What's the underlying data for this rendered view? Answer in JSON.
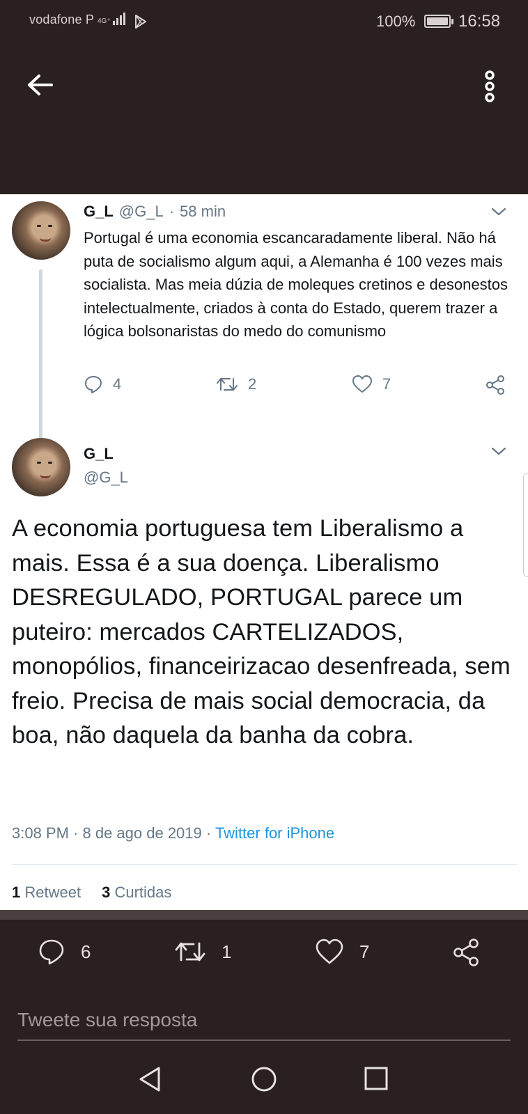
{
  "status_bar": {
    "carrier": "vodafone P",
    "network": "4G⁺",
    "battery_percent": "100%",
    "time": "16:58"
  },
  "header": {
    "back_icon": "arrow-left-icon",
    "menu_icon": "more-vertical-icon"
  },
  "parent_tweet": {
    "name": "G_L",
    "handle": "@G_L",
    "separator": "·",
    "time": "58 min",
    "text": "Portugal é uma economia escancaradamente liberal. Não há puta de socialismo algum aqui, a Alemanha é 100 vezes  mais socialista. Mas meia dúzia de moleques cretinos e desonestos intelectualmente, criados à conta do Estado, querem trazer a lógica bolsonaristas do medo do comunismo",
    "replies": "4",
    "retweets": "2",
    "likes": "7"
  },
  "main_tweet": {
    "name": "G_L",
    "handle": "@G_L",
    "text": "A economia portuguesa tem Liberalismo a mais. Essa é a sua doença. Liberalismo DESREGULADO, PORTUGAL parece um puteiro: mercados CARTELIZADOS, monopólios, financeirizacao desenfreada, sem freio. Precisa de mais social democracia, da boa, não daquela da banha da cobra.",
    "timestamp": "3:08 PM · 8 de ago de 2019",
    "meta_separator": "·",
    "source": "Twitter for iPhone",
    "retweet_count": "1",
    "retweet_label": "Retweet",
    "like_count": "3",
    "like_label": "Curtidas"
  },
  "action_bar": {
    "replies": "6",
    "retweets": "1",
    "likes": "7"
  },
  "reply_box": {
    "placeholder": "Tweete sua resposta"
  },
  "colors": {
    "dark_background": "#2a2020",
    "text_primary": "#14171a",
    "text_secondary": "#657786",
    "link": "#1b95e0"
  }
}
